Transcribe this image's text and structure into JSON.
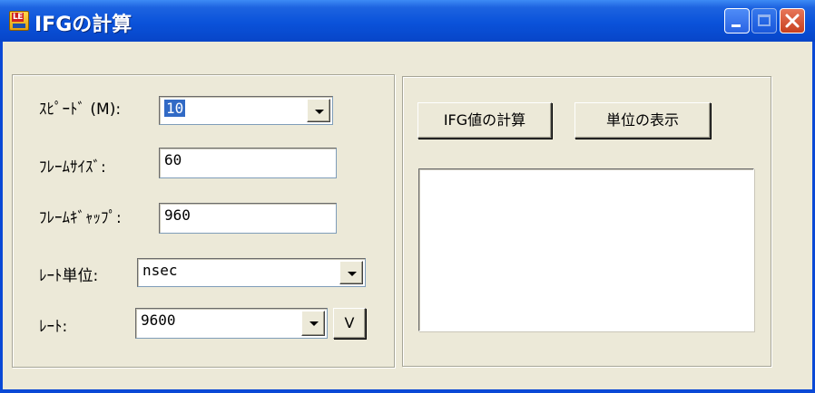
{
  "window": {
    "title": "IFGの計算",
    "app_icon_text": "LE"
  },
  "form": {
    "speed": {
      "label": "ｽﾋﾟｰﾄﾞ (M):",
      "value": "10"
    },
    "frame_size": {
      "label": "ﾌﾚｰﾑｻｲｽﾞ:",
      "value": "60"
    },
    "frame_gap": {
      "label": "ﾌﾚｰﾑｷﾞｬｯﾌﾟ:",
      "value": "960"
    },
    "rate_unit": {
      "label": "ﾚｰﾄ単位:",
      "value": "nsec"
    },
    "rate": {
      "label": "ﾚｰﾄ:",
      "value": "9600",
      "v_button": "V"
    }
  },
  "actions": {
    "calc_button": "IFG値の計算",
    "unit_button": "単位の表示"
  },
  "colors": {
    "titlebar": "#0a52da",
    "window_bg": "#ece9d8",
    "selection": "#316ac5"
  }
}
